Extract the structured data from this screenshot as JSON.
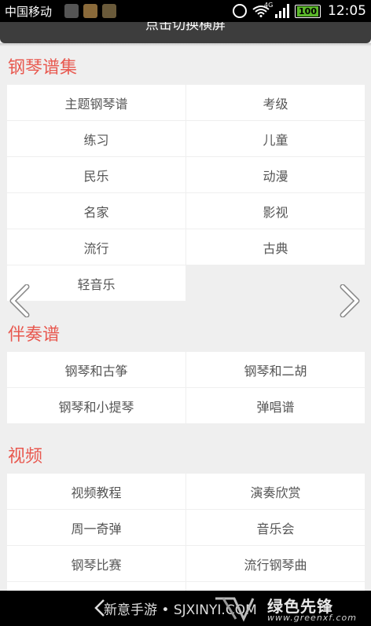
{
  "status_bar": {
    "carrier": "中国移动",
    "network_type": "4G",
    "battery": "100",
    "time": "12:05"
  },
  "top_button": {
    "label": "点击切换横屏"
  },
  "sections": [
    {
      "title": "钢琴谱集",
      "items": [
        "主题钢琴谱",
        "考级",
        "练习",
        "儿童",
        "民乐",
        "动漫",
        "名家",
        "影视",
        "流行",
        "古典",
        "轻音乐"
      ]
    },
    {
      "title": "伴奏谱",
      "items": [
        "钢琴和古筝",
        "钢琴和二胡",
        "钢琴和小提琴",
        "弹唱谱"
      ]
    },
    {
      "title": "视频",
      "items": [
        "视频教程",
        "演奏欣赏",
        "周一奇弹",
        "音乐会",
        "钢琴比赛",
        "流行钢琴曲"
      ]
    }
  ],
  "bottom_bar": {
    "watermark_left": "新意手游 • SJXINYI.COM",
    "logo_text": "绿色先锋",
    "logo_url": "www.greenxf.com"
  },
  "icons": {
    "prev": "chevron-left-icon",
    "next": "chevron-right-icon"
  }
}
